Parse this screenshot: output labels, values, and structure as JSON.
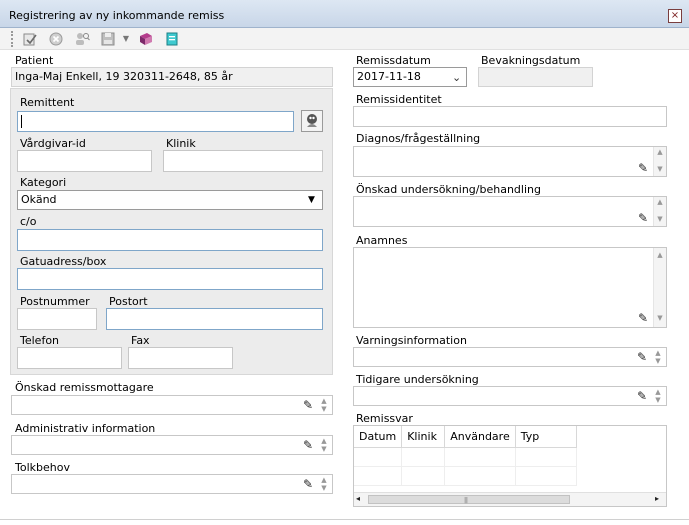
{
  "window": {
    "title": "Registrering av ny inkommande remiss",
    "close_icon": "×"
  },
  "toolbar": {
    "icons": [
      "edit-icon",
      "cancel-icon",
      "user-search-icon",
      "save-icon",
      "dropdown-arrow-icon",
      "book-icon",
      "document-icon"
    ]
  },
  "patient": {
    "label": "Patient",
    "value": "Inga-Maj Enkell, 19 320311-2648, 85 år"
  },
  "remittent": {
    "group_label": "Remittent",
    "value": "",
    "vardgivar_label": "Vårdgivar-id",
    "klinik_label": "Klinik",
    "kategori_label": "Kategori",
    "kategori_value": "Okänd",
    "co_label": "c/o",
    "gatuadress_label": "Gatuadress/box",
    "postnummer_label": "Postnummer",
    "postort_label": "Postort",
    "telefon_label": "Telefon",
    "fax_label": "Fax"
  },
  "left_fields": {
    "mottagare_label": "Önskad remissmottagare",
    "admin_label": "Administrativ information",
    "tolk_label": "Tolkbehov"
  },
  "right": {
    "remissdatum_label": "Remissdatum",
    "remissdatum_value": "2017-11-18",
    "bevakning_label": "Bevakningsdatum",
    "identitet_label": "Remissidentitet",
    "diagnos_label": "Diagnos/frågeställning",
    "undersokning_label": "Önskad undersökning/behandling",
    "anamnes_label": "Anamnes",
    "varning_label": "Varningsinformation",
    "tidigare_label": "Tidigare undersökning",
    "remissvar_label": "Remissvar"
  },
  "remissvar_table": {
    "columns": [
      "Datum",
      "Klinik",
      "Användare",
      "Typ"
    ]
  }
}
